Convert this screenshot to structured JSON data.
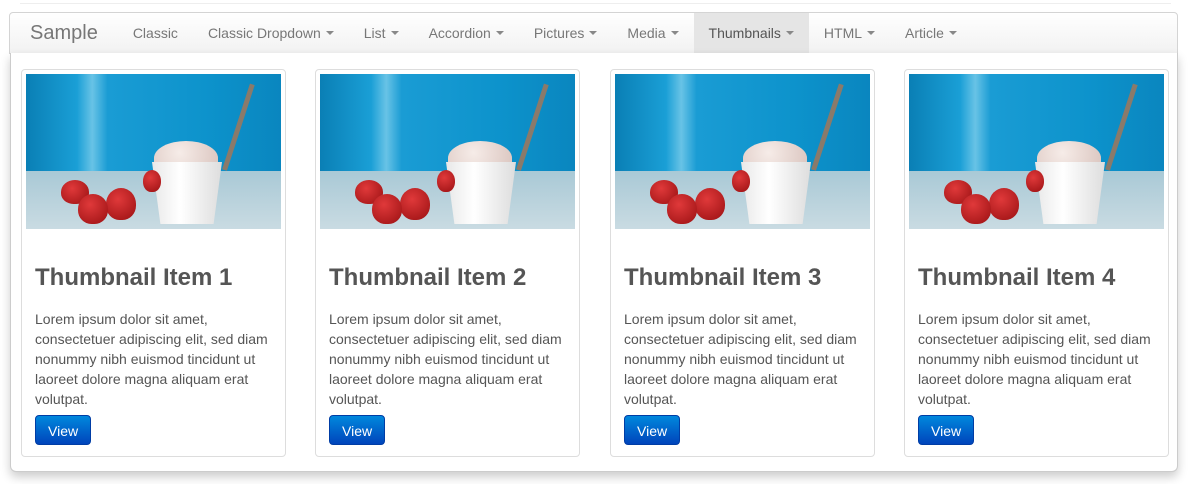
{
  "navbar": {
    "brand": "Sample",
    "items": [
      {
        "label": "Classic",
        "dropdown": false,
        "active": false
      },
      {
        "label": "Classic Dropdown",
        "dropdown": true,
        "active": false
      },
      {
        "label": "List",
        "dropdown": true,
        "active": false
      },
      {
        "label": "Accordion",
        "dropdown": true,
        "active": false
      },
      {
        "label": "Pictures",
        "dropdown": true,
        "active": false
      },
      {
        "label": "Media",
        "dropdown": true,
        "active": false
      },
      {
        "label": "Thumbnails",
        "dropdown": true,
        "active": true
      },
      {
        "label": "HTML",
        "dropdown": true,
        "active": false
      },
      {
        "label": "Article",
        "dropdown": true,
        "active": false
      }
    ]
  },
  "thumbnails": [
    {
      "title": "Thumbnail Item 1",
      "text": "Lorem ipsum dolor sit amet, consectetuer adipiscing elit, sed diam nonummy nibh euismod tincidunt ut laoreet dolore magna aliquam erat volutpat.",
      "button": "View"
    },
    {
      "title": "Thumbnail Item 2",
      "text": "Lorem ipsum dolor sit amet, consectetuer adipiscing elit, sed diam nonummy nibh euismod tincidunt ut laoreet dolore magna aliquam erat volutpat.",
      "button": "View"
    },
    {
      "title": "Thumbnail Item 3",
      "text": "Lorem ipsum dolor sit amet, consectetuer adipiscing elit, sed diam nonummy nibh euismod tincidunt ut laoreet dolore magna aliquam erat volutpat.",
      "button": "View"
    },
    {
      "title": "Thumbnail Item 4",
      "text": "Lorem ipsum dolor sit amet, consectetuer adipiscing elit, sed diam nonummy nibh euismod tincidunt ut laoreet dolore magna aliquam erat volutpat.",
      "button": "View"
    }
  ],
  "colors": {
    "button": "#0066cc",
    "active_nav": "#e5e5e5",
    "text": "#555555"
  }
}
